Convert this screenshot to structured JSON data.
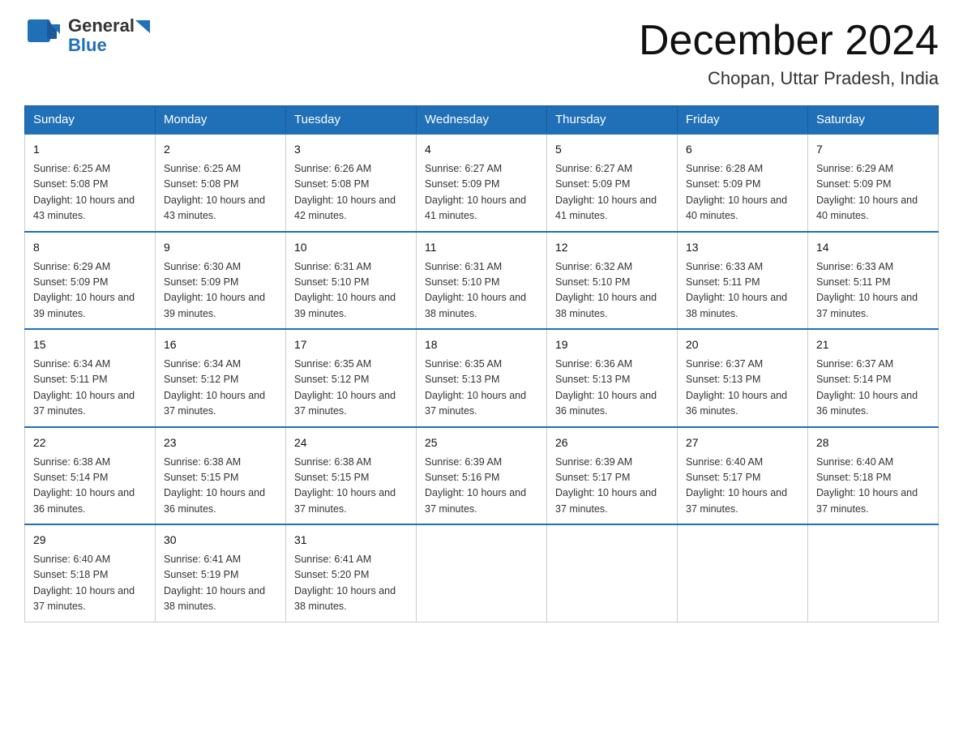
{
  "header": {
    "logo_general": "General",
    "logo_blue": "Blue",
    "title": "December 2024",
    "subtitle": "Chopan, Uttar Pradesh, India"
  },
  "days_of_week": [
    "Sunday",
    "Monday",
    "Tuesday",
    "Wednesday",
    "Thursday",
    "Friday",
    "Saturday"
  ],
  "weeks": [
    [
      {
        "day": "1",
        "sunrise": "6:25 AM",
        "sunset": "5:08 PM",
        "daylight": "10 hours and 43 minutes."
      },
      {
        "day": "2",
        "sunrise": "6:25 AM",
        "sunset": "5:08 PM",
        "daylight": "10 hours and 43 minutes."
      },
      {
        "day": "3",
        "sunrise": "6:26 AM",
        "sunset": "5:08 PM",
        "daylight": "10 hours and 42 minutes."
      },
      {
        "day": "4",
        "sunrise": "6:27 AM",
        "sunset": "5:09 PM",
        "daylight": "10 hours and 41 minutes."
      },
      {
        "day": "5",
        "sunrise": "6:27 AM",
        "sunset": "5:09 PM",
        "daylight": "10 hours and 41 minutes."
      },
      {
        "day": "6",
        "sunrise": "6:28 AM",
        "sunset": "5:09 PM",
        "daylight": "10 hours and 40 minutes."
      },
      {
        "day": "7",
        "sunrise": "6:29 AM",
        "sunset": "5:09 PM",
        "daylight": "10 hours and 40 minutes."
      }
    ],
    [
      {
        "day": "8",
        "sunrise": "6:29 AM",
        "sunset": "5:09 PM",
        "daylight": "10 hours and 39 minutes."
      },
      {
        "day": "9",
        "sunrise": "6:30 AM",
        "sunset": "5:09 PM",
        "daylight": "10 hours and 39 minutes."
      },
      {
        "day": "10",
        "sunrise": "6:31 AM",
        "sunset": "5:10 PM",
        "daylight": "10 hours and 39 minutes."
      },
      {
        "day": "11",
        "sunrise": "6:31 AM",
        "sunset": "5:10 PM",
        "daylight": "10 hours and 38 minutes."
      },
      {
        "day": "12",
        "sunrise": "6:32 AM",
        "sunset": "5:10 PM",
        "daylight": "10 hours and 38 minutes."
      },
      {
        "day": "13",
        "sunrise": "6:33 AM",
        "sunset": "5:11 PM",
        "daylight": "10 hours and 38 minutes."
      },
      {
        "day": "14",
        "sunrise": "6:33 AM",
        "sunset": "5:11 PM",
        "daylight": "10 hours and 37 minutes."
      }
    ],
    [
      {
        "day": "15",
        "sunrise": "6:34 AM",
        "sunset": "5:11 PM",
        "daylight": "10 hours and 37 minutes."
      },
      {
        "day": "16",
        "sunrise": "6:34 AM",
        "sunset": "5:12 PM",
        "daylight": "10 hours and 37 minutes."
      },
      {
        "day": "17",
        "sunrise": "6:35 AM",
        "sunset": "5:12 PM",
        "daylight": "10 hours and 37 minutes."
      },
      {
        "day": "18",
        "sunrise": "6:35 AM",
        "sunset": "5:13 PM",
        "daylight": "10 hours and 37 minutes."
      },
      {
        "day": "19",
        "sunrise": "6:36 AM",
        "sunset": "5:13 PM",
        "daylight": "10 hours and 36 minutes."
      },
      {
        "day": "20",
        "sunrise": "6:37 AM",
        "sunset": "5:13 PM",
        "daylight": "10 hours and 36 minutes."
      },
      {
        "day": "21",
        "sunrise": "6:37 AM",
        "sunset": "5:14 PM",
        "daylight": "10 hours and 36 minutes."
      }
    ],
    [
      {
        "day": "22",
        "sunrise": "6:38 AM",
        "sunset": "5:14 PM",
        "daylight": "10 hours and 36 minutes."
      },
      {
        "day": "23",
        "sunrise": "6:38 AM",
        "sunset": "5:15 PM",
        "daylight": "10 hours and 36 minutes."
      },
      {
        "day": "24",
        "sunrise": "6:38 AM",
        "sunset": "5:15 PM",
        "daylight": "10 hours and 37 minutes."
      },
      {
        "day": "25",
        "sunrise": "6:39 AM",
        "sunset": "5:16 PM",
        "daylight": "10 hours and 37 minutes."
      },
      {
        "day": "26",
        "sunrise": "6:39 AM",
        "sunset": "5:17 PM",
        "daylight": "10 hours and 37 minutes."
      },
      {
        "day": "27",
        "sunrise": "6:40 AM",
        "sunset": "5:17 PM",
        "daylight": "10 hours and 37 minutes."
      },
      {
        "day": "28",
        "sunrise": "6:40 AM",
        "sunset": "5:18 PM",
        "daylight": "10 hours and 37 minutes."
      }
    ],
    [
      {
        "day": "29",
        "sunrise": "6:40 AM",
        "sunset": "5:18 PM",
        "daylight": "10 hours and 37 minutes."
      },
      {
        "day": "30",
        "sunrise": "6:41 AM",
        "sunset": "5:19 PM",
        "daylight": "10 hours and 38 minutes."
      },
      {
        "day": "31",
        "sunrise": "6:41 AM",
        "sunset": "5:20 PM",
        "daylight": "10 hours and 38 minutes."
      },
      null,
      null,
      null,
      null
    ]
  ]
}
